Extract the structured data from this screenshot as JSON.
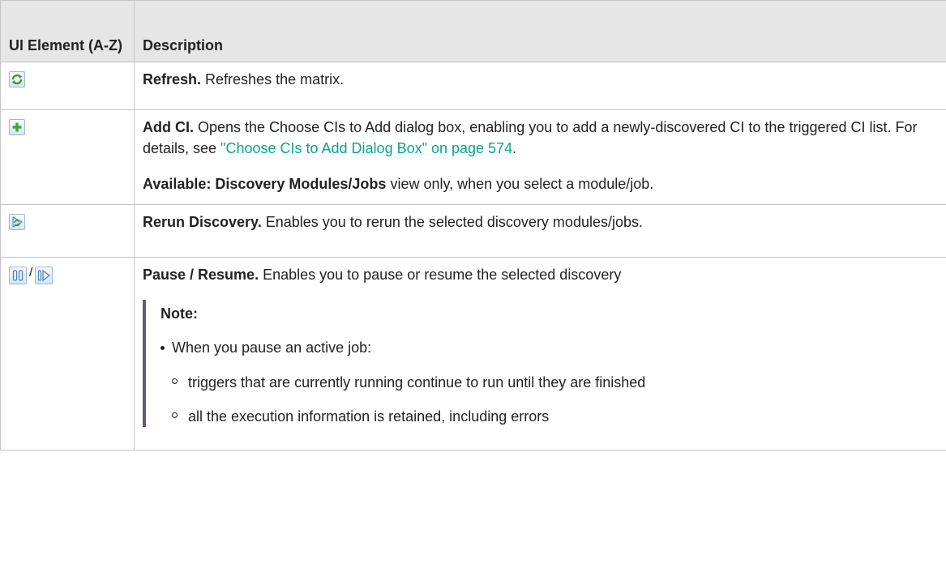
{
  "header": {
    "col1": "UI Element (A-Z)",
    "col2": "Description"
  },
  "rows": {
    "refresh": {
      "icon": "refresh-icon",
      "title": "Refresh.",
      "text": " Refreshes the matrix."
    },
    "add_ci": {
      "icon": "add-icon",
      "title": "Add CI.",
      "text": " Opens the Choose CIs to Add dialog box, enabling you to add a newly-discovered CI to the triggered CI list. For details, see ",
      "link": "\"Choose CIs to Add Dialog Box\" on page 574",
      "after_link": ".",
      "avail_bold": "Available: Discovery Modules/Jobs",
      "avail_text": " view only, when you select a module/job."
    },
    "rerun": {
      "icon": "rerun-discovery-icon",
      "title": "Rerun Discovery.",
      "text": " Enables you to rerun the selected discovery modules/jobs."
    },
    "pause_resume": {
      "icons": [
        "pause-icon",
        "resume-icon"
      ],
      "separator": "/",
      "title": "Pause / Resume.",
      "text": " Enables you to pause or resume the selected discovery",
      "note_title": "Note:",
      "bullet": "When you pause an active job:",
      "sub_bullets": [
        "triggers that are currently running continue to run until they are finished",
        "all the execution information is retained, including errors"
      ]
    }
  },
  "colors": {
    "header_bg": "#e6e6e6",
    "link": "#0aa58a",
    "note_bar": "#6a5a72",
    "border": "#c4c4c4"
  }
}
